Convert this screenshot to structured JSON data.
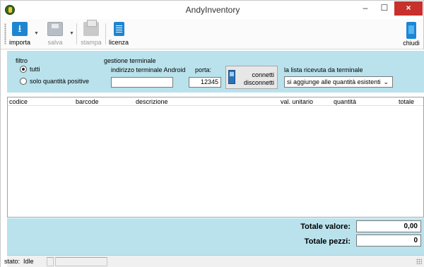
{
  "window": {
    "title": "AndyInventory",
    "minimize": "–",
    "maximize": "☐",
    "close": "×"
  },
  "toolbar": {
    "import": "importa",
    "save": "salva",
    "print": "stampa",
    "license": "licenza",
    "close": "chiudi"
  },
  "filter": {
    "title": "filtro",
    "option_all": "tutti",
    "option_positive": "solo quantità positive",
    "selected": "tutti"
  },
  "terminal": {
    "title": "gestione terminale",
    "address_label": "indirizzo terminale Android",
    "address_value": "",
    "port_label": "porta:",
    "port_value": "12345",
    "connect": "connetti",
    "disconnect": "disconnetti",
    "list_label": "la lista ricevuta da terminale",
    "list_mode": "si aggiunge alle quantità esistenti"
  },
  "table": {
    "columns": [
      "codice",
      "barcode",
      "descrizione",
      "val. unitario",
      "quantità",
      "totale"
    ],
    "rows": []
  },
  "totals": {
    "value_label": "Totale valore:",
    "value": "0,00",
    "pieces_label": "Totale pezzi:",
    "pieces": "0"
  },
  "status": {
    "label": "stato:",
    "value": "Idle"
  }
}
